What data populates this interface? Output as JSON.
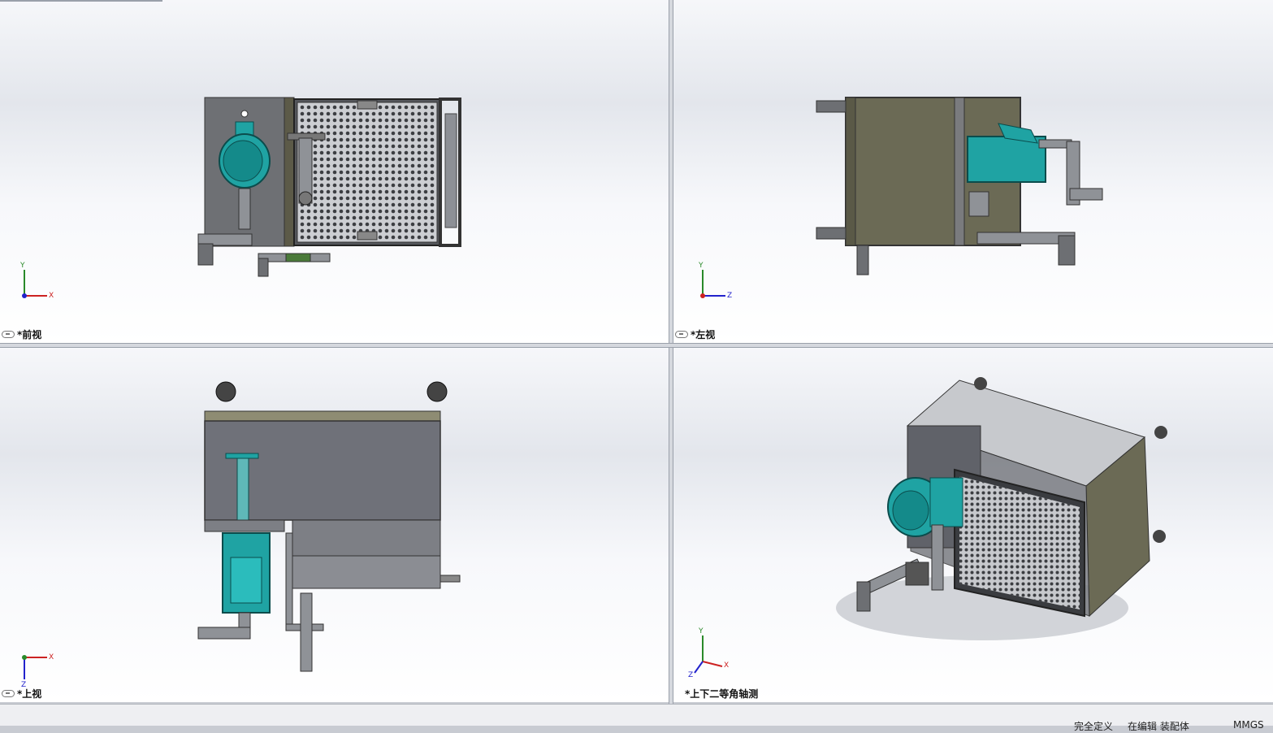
{
  "viewports": {
    "front": {
      "label": "*前视"
    },
    "left": {
      "label": "*左视"
    },
    "top": {
      "label": "*上视"
    },
    "iso": {
      "label": "*上下二等角轴测"
    }
  },
  "axes": {
    "front": {
      "a": "Y",
      "b": "X"
    },
    "left": {
      "a": "Y",
      "b": "Z"
    },
    "top": {
      "a": "X",
      "b": "Z"
    },
    "iso": {
      "a": "Y",
      "b": "X",
      "c": "Z"
    }
  },
  "statusbar": {
    "item1": "完全定义",
    "item2": "在编辑 装配体",
    "item3": "MMGS"
  },
  "colors": {
    "teal": "#1fa3a3",
    "tank": "#6b6a55",
    "gray": "#6e7074"
  }
}
